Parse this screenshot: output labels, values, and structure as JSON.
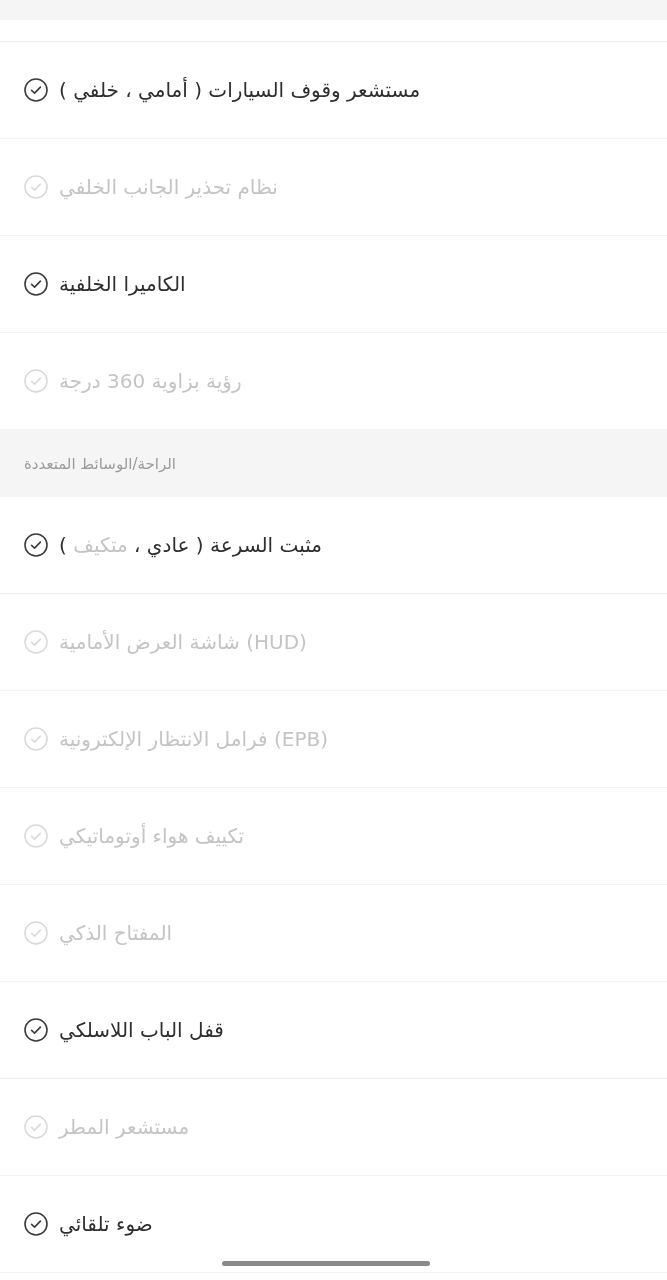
{
  "sections": [
    {
      "items": [
        {
          "label": "مستشعر وقوف السيارات ( أمامي ، خلفي )",
          "checked": true
        },
        {
          "label": "نظام تحذير الجانب الخلفي",
          "checked": false
        },
        {
          "label": "الكاميرا الخلفية",
          "checked": true
        },
        {
          "label": "رؤية بزاوية 360 درجة",
          "checked": false
        }
      ]
    },
    {
      "title": "الراحة/الوسائط المتعددة",
      "items": [
        {
          "checked": true,
          "label_parts": [
            {
              "text": "مثبت السرعة ( عادي ، ",
              "included": true
            },
            {
              "text": "متكيف",
              "included": false
            },
            {
              "text": " )",
              "included": true
            }
          ]
        },
        {
          "label": "(HUD) شاشة العرض الأمامية",
          "checked": false
        },
        {
          "label": "(EPB) فرامل الانتظار الإلكترونية",
          "checked": false
        },
        {
          "label": "تكييف هواء أوتوماتيكي",
          "checked": false
        },
        {
          "label": "المفتاح الذكي",
          "checked": false
        },
        {
          "label": "قفل الباب اللاسلكي",
          "checked": true
        },
        {
          "label": "مستشعر المطر",
          "checked": false
        },
        {
          "label": "ضوء تلقائي",
          "checked": true
        }
      ]
    }
  ]
}
